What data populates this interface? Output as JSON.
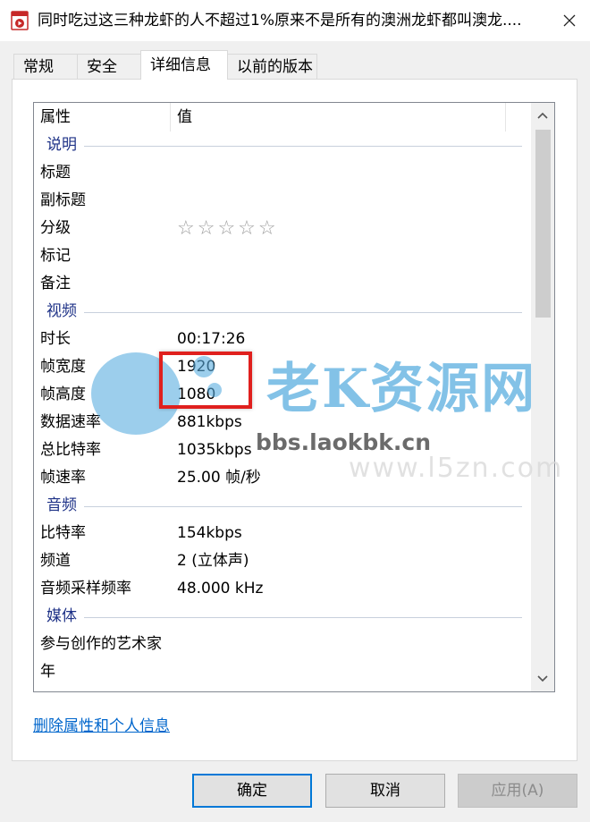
{
  "window": {
    "title": "同时吃过这三种龙虾的人不超过1%原来不是所有的澳洲龙虾都叫澳龙....",
    "app_icon": "video-file-icon",
    "close_icon": "close-icon"
  },
  "tabs": [
    {
      "label": "常规",
      "active": false
    },
    {
      "label": "安全",
      "active": false
    },
    {
      "label": "详细信息",
      "active": true
    },
    {
      "label": "以前的版本",
      "active": false
    }
  ],
  "list": {
    "header": {
      "name": "属性",
      "value": "值"
    },
    "groups": [
      {
        "label": "说明",
        "rows": [
          {
            "name": "标题",
            "value": ""
          },
          {
            "name": "副标题",
            "value": ""
          },
          {
            "name": "分级",
            "value": "",
            "stars": "☆☆☆☆☆",
            "rating": 0
          },
          {
            "name": "标记",
            "value": ""
          },
          {
            "name": "备注",
            "value": ""
          }
        ]
      },
      {
        "label": "视频",
        "rows": [
          {
            "name": "时长",
            "value": "00:17:26"
          },
          {
            "name": "帧宽度",
            "value": "1920"
          },
          {
            "name": "帧高度",
            "value": "1080"
          },
          {
            "name": "数据速率",
            "value": "881kbps"
          },
          {
            "name": "总比特率",
            "value": "1035kbps"
          },
          {
            "name": "帧速率",
            "value": "25.00 帧/秒"
          }
        ]
      },
      {
        "label": "音频",
        "rows": [
          {
            "name": "比特率",
            "value": "154kbps"
          },
          {
            "name": "频道",
            "value": "2 (立体声)"
          },
          {
            "name": "音频采样频率",
            "value": "48.000 kHz"
          }
        ]
      },
      {
        "label": "媒体",
        "rows": [
          {
            "name": "参与创作的艺术家",
            "value": ""
          },
          {
            "name": "年",
            "value": ""
          }
        ]
      }
    ]
  },
  "watermark": {
    "text": "老K资源网",
    "url": "bbs.laokbk.cn",
    "url2": "www.l5zn.com"
  },
  "remove_link": "删除属性和个人信息",
  "buttons": {
    "ok": "确定",
    "cancel": "取消",
    "apply": "应用(A)"
  },
  "colors": {
    "group_header": "#1e3287",
    "link": "#0066cc",
    "highlight": "#e0201e",
    "primary_border": "#0078d7"
  }
}
